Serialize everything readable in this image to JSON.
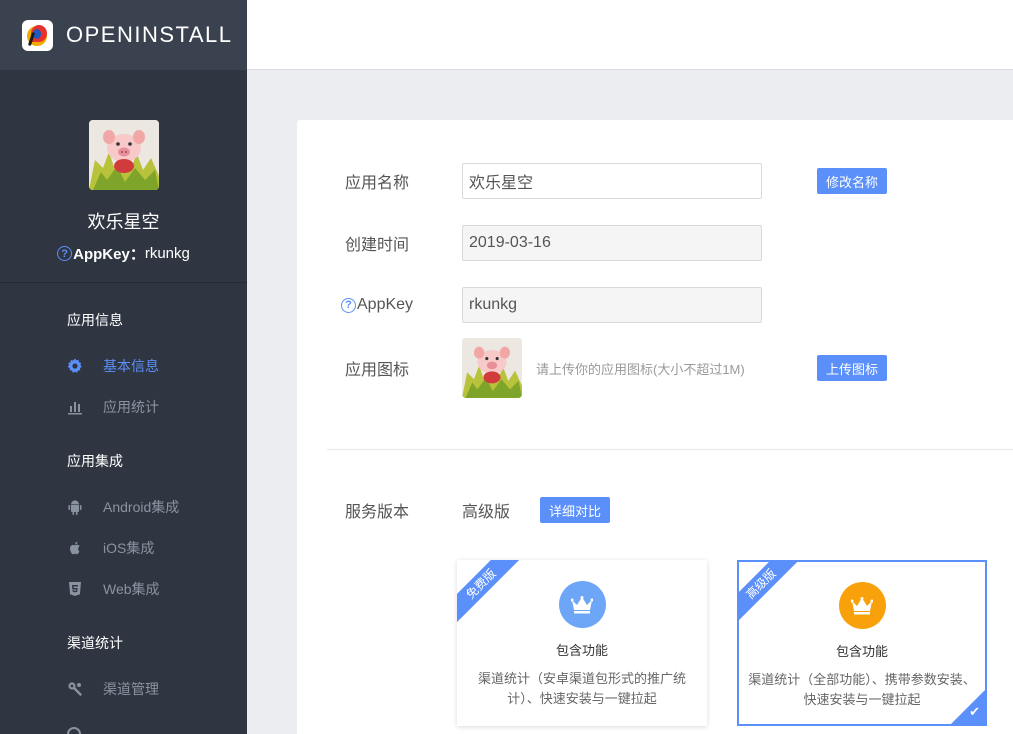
{
  "brand": {
    "name": "OPENINSTALL"
  },
  "profile": {
    "app_name": "欢乐星空",
    "appkey_label": "AppKey：",
    "appkey_value": "rkunkg"
  },
  "nav": {
    "sections": [
      {
        "title": "应用信息",
        "items": [
          {
            "label": "基本信息",
            "icon": "gear-icon",
            "active": true
          },
          {
            "label": "应用统计",
            "icon": "bar-chart-icon"
          }
        ]
      },
      {
        "title": "应用集成",
        "items": [
          {
            "label": "Android集成",
            "icon": "android-icon"
          },
          {
            "label": "iOS集成",
            "icon": "apple-icon"
          },
          {
            "label": "Web集成",
            "icon": "html5-icon"
          }
        ]
      },
      {
        "title": "渠道统计",
        "items": [
          {
            "label": "渠道管理",
            "icon": "wrench-icon"
          }
        ]
      }
    ]
  },
  "form": {
    "name_label": "应用名称",
    "name_value": "欢乐星空",
    "rename_button": "修改名称",
    "created_label": "创建时间",
    "created_value": "2019-03-16",
    "appkey_label": "AppKey",
    "appkey_value": "rkunkg",
    "icon_label": "应用图标",
    "icon_hint": "请上传你的应用图标(大小不超过1M)",
    "upload_button": "上传图标"
  },
  "service": {
    "label": "服务版本",
    "current": "高级版",
    "compare_button": "详细对比",
    "plans": [
      {
        "badge": "免费版",
        "title": "包含功能",
        "desc": "渠道统计（安卓渠道包形式的推广统计）、快速安装与一键拉起",
        "color": "#6ea6f7"
      },
      {
        "badge": "高级版",
        "title": "包含功能",
        "desc": "渠道统计（全部功能）、携带参数安装、快速安装与一键拉起",
        "color": "#f8a10a",
        "selected": true
      }
    ]
  },
  "colors": {
    "sidebar": "#2f3641",
    "accent": "#5b8ff9",
    "premium": "#f8a10a"
  }
}
